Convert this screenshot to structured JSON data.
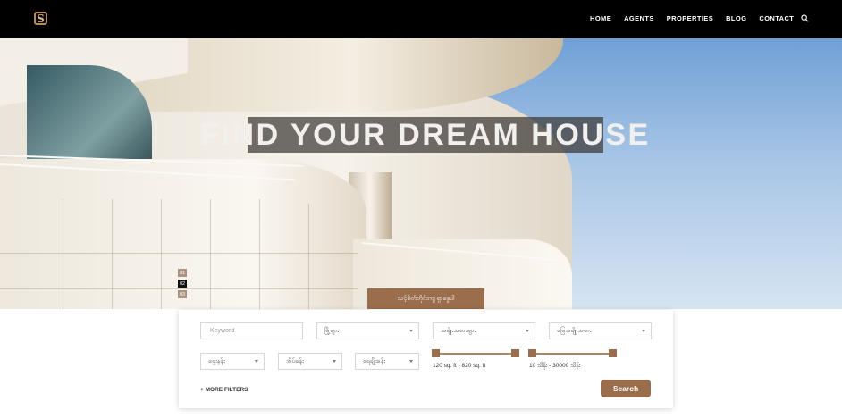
{
  "header": {
    "logo_letter": "S",
    "nav": [
      "HOME",
      "AGENTS",
      "PROPERTIES",
      "BLOG",
      "CONTACT"
    ]
  },
  "hero": {
    "headline": "FIND YOUR DREAM HOUSE",
    "slides": [
      "01",
      "02",
      "03"
    ],
    "active_slide": "02",
    "tab_label": "သင့်စိတ်တိုင်းကျ ရှာဖွေပါ"
  },
  "search": {
    "keyword_placeholder": "Keyword",
    "city": "မြို့များ",
    "type": "အမျိုးအစားများ",
    "land_type": "မြေအမျိုးအစား",
    "location": "ရှေးနန်း",
    "bedrooms": "အိပ်ခန်း",
    "bathrooms": "ရေချိုးခန်း",
    "area_range": "120 sq. ft - 820 sq. ft",
    "price_range": "10 သိန်း - 30000 သိန်း",
    "more_filters": "+ MORE FILTERS",
    "search_button": "Search"
  },
  "colors": {
    "accent": "#9a6e4c",
    "header_bg": "#000000"
  },
  "icons": [
    "logo-icon",
    "search-icon",
    "caret-down-icon"
  ]
}
